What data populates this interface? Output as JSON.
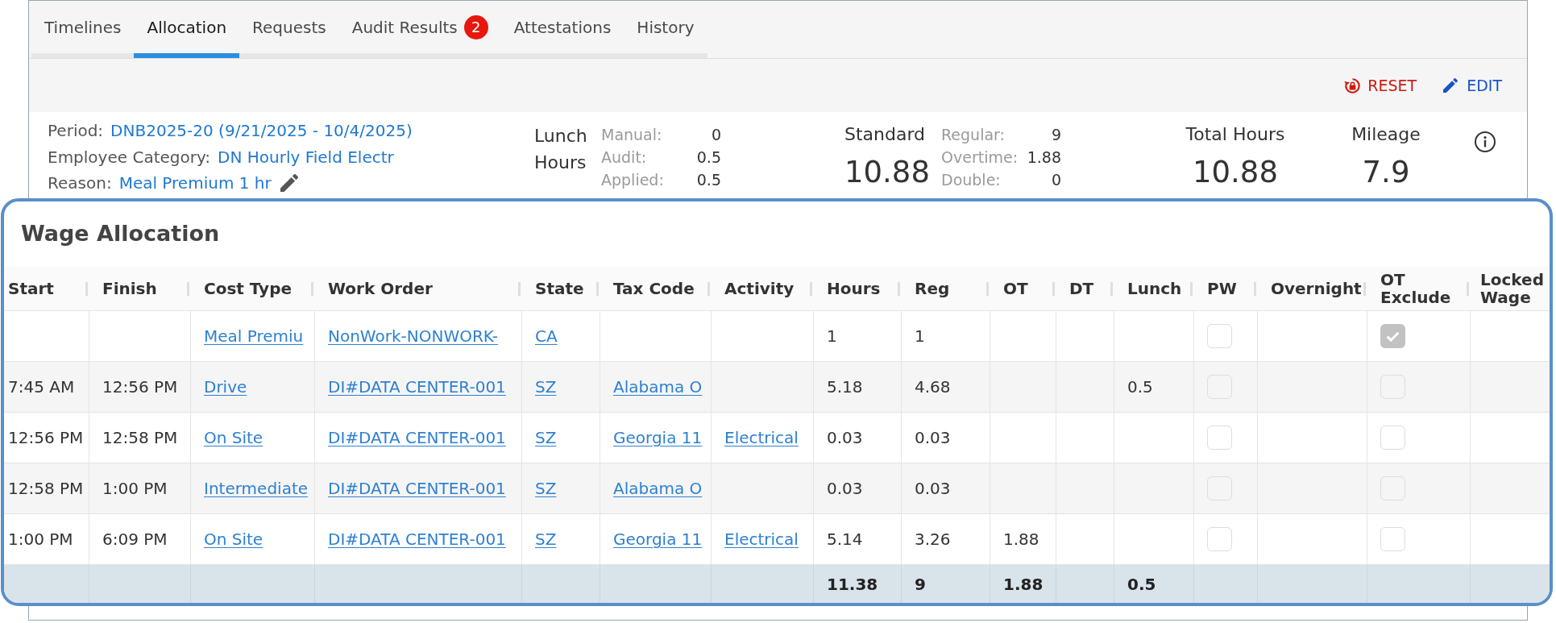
{
  "tabs": [
    {
      "label": "Timelines",
      "selected": false
    },
    {
      "label": "Allocation",
      "selected": true
    },
    {
      "label": "Requests",
      "selected": false
    },
    {
      "label": "Audit Results",
      "selected": false,
      "badge": "2"
    },
    {
      "label": "Attestations",
      "selected": false
    },
    {
      "label": "History",
      "selected": false
    }
  ],
  "actions": [
    {
      "kind": "reset",
      "label": "RESET"
    },
    {
      "kind": "edit",
      "label": "EDIT"
    }
  ],
  "details": [
    {
      "label": "Period:",
      "value": "DNB2025-20 (9/21/2025 - 10/4/2025)",
      "editable": false
    },
    {
      "label": "Employee Category:",
      "value": "DN Hourly Field Electr",
      "editable": false
    },
    {
      "label": "Reason:",
      "value": "Meal Premium 1 hr",
      "editable": true
    }
  ],
  "lunch_hours": {
    "title": "Lunch Hours",
    "breakdown": [
      {
        "label": "Manual:",
        "value": "0"
      },
      {
        "label": "Audit:",
        "value": "0.5"
      },
      {
        "label": "Applied:",
        "value": "0.5"
      }
    ]
  },
  "standard": {
    "title": "Standard",
    "value": "10.88",
    "breakdown": [
      {
        "label": "Regular:",
        "value": "9"
      },
      {
        "label": "Overtime:",
        "value": "1.88"
      },
      {
        "label": "Double:",
        "value": "0"
      }
    ]
  },
  "summary": [
    {
      "label": "Total Hours",
      "value": "10.88"
    },
    {
      "label": "Mileage",
      "value": "7.9"
    }
  ],
  "wage_allocation": {
    "title": "Wage Allocation",
    "columns": [
      {
        "label": "Start",
        "kind": "text"
      },
      {
        "label": "Finish",
        "kind": "text"
      },
      {
        "label": "Cost Type",
        "kind": "link"
      },
      {
        "label": "Work Order",
        "kind": "link"
      },
      {
        "label": "State",
        "kind": "link"
      },
      {
        "label": "Tax Code",
        "kind": "link"
      },
      {
        "label": "Activity",
        "kind": "link"
      },
      {
        "label": "Hours",
        "kind": "text"
      },
      {
        "label": "Reg",
        "kind": "text"
      },
      {
        "label": "OT",
        "kind": "text"
      },
      {
        "label": "DT",
        "kind": "text"
      },
      {
        "label": "Lunch",
        "kind": "text"
      },
      {
        "label": "PW",
        "kind": "check"
      },
      {
        "label": "Overnight",
        "kind": "text"
      },
      {
        "label": "OT Exclude",
        "kind": "check"
      },
      {
        "label": "Locked Wage",
        "kind": "text"
      }
    ],
    "rows": [
      {
        "cost_type": "Meal Premiu",
        "work_order": "NonWork-NONWORK-",
        "state": "CA",
        "hours": "1",
        "reg": "1",
        "pw": false,
        "ot_exclude": true
      },
      {
        "start": "7:45 AM",
        "finish": "12:56 PM",
        "cost_type": "Drive",
        "work_order": "DI#DATA CENTER-001",
        "state": "SZ",
        "tax_code": "Alabama O",
        "hours": "5.18",
        "reg": "4.68",
        "lunch": "0.5",
        "pw": false,
        "ot_exclude": false
      },
      {
        "start": "12:56 PM",
        "finish": "12:58 PM",
        "cost_type": "On Site",
        "work_order": "DI#DATA CENTER-001",
        "state": "SZ",
        "tax_code": "Georgia 11",
        "activity": "Electrical",
        "hours": "0.03",
        "reg": "0.03",
        "pw": false,
        "ot_exclude": false
      },
      {
        "start": "12:58 PM",
        "finish": "1:00 PM",
        "cost_type": "Intermediate",
        "work_order": "DI#DATA CENTER-001",
        "state": "SZ",
        "tax_code": "Alabama O",
        "hours": "0.03",
        "reg": "0.03",
        "pw": false,
        "ot_exclude": false
      },
      {
        "start": "1:00 PM",
        "finish": "6:09 PM",
        "cost_type": "On Site",
        "work_order": "DI#DATA CENTER-001",
        "state": "SZ",
        "tax_code": "Georgia 11",
        "activity": "Electrical",
        "hours": "5.14",
        "reg": "3.26",
        "ot": "1.88",
        "pw": false,
        "ot_exclude": false
      }
    ],
    "totals": {
      "hours": "11.38",
      "reg": "9",
      "ot": "1.88",
      "lunch": "0.5"
    }
  }
}
